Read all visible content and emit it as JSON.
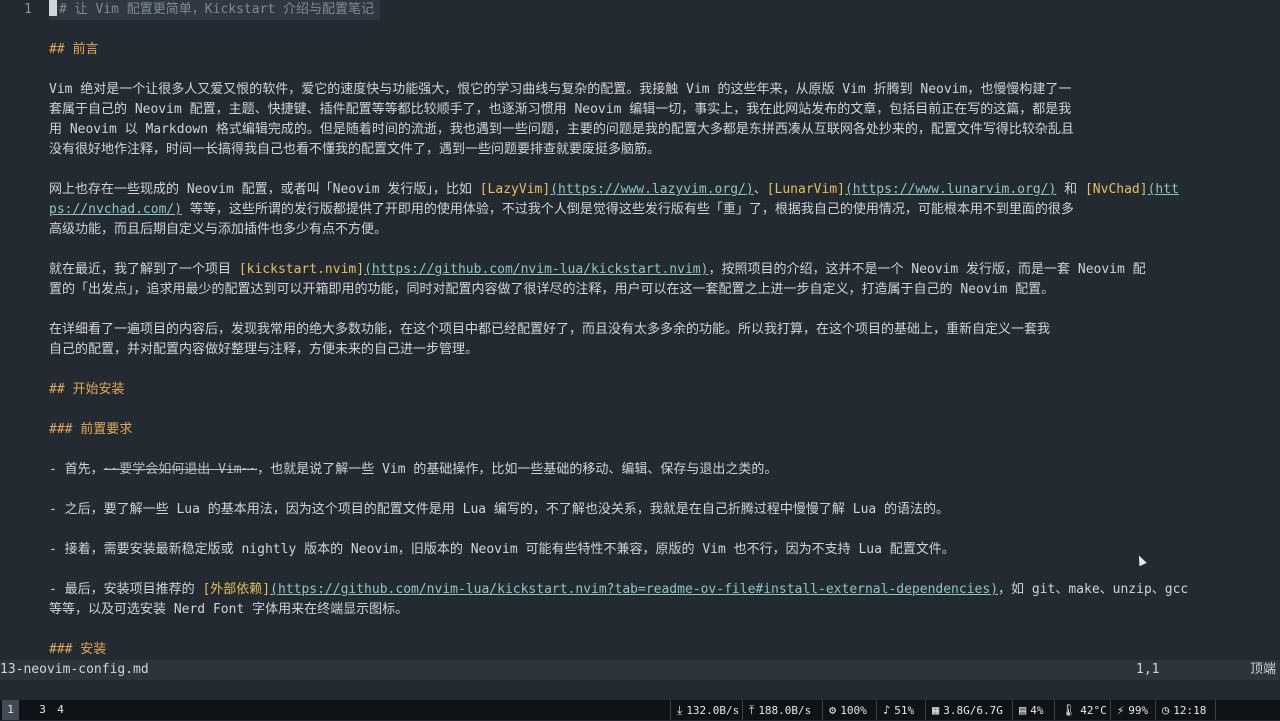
{
  "editor": {
    "line_number": "1",
    "title": "# 让 Vim 配置更简单，Kickstart 介绍与配置笔记",
    "h_preface": "## 前言",
    "p1": [
      "Vim 绝对是一个让很多人又爱又恨的软件，爱它的速度快与功能强大，恨它的学习曲线与复杂的配置。我接触 Vim 的这些年来，从原版 Vim 折腾到 Neovim，也慢慢构建了一",
      "套属于自己的 Neovim 配置，主题、快捷键、插件配置等等都比较顺手了，也逐渐习惯用 Neovim 编辑一切，事实上，我在此网站发布的文章，包括目前正在写的这篇，都是我",
      "用 Neovim 以 Markdown 格式编辑完成的。但是随着时间的流逝，我也遇到一些问题，主要的问题是我的配置大多都是东拼西凑从互联网各处抄来的，配置文件写得比较杂乱且",
      "没有很好地作注释，时间一长搞得我自己也看不懂我的配置文件了，遇到一些问题要排查就要废挺多脑筋。"
    ],
    "p2": {
      "l1_pre": "网上也存在一些现成的 Neovim 配置，或者叫「Neovim 发行版」，比如 ",
      "l1_link1": "[LazyVim]",
      "l1_url1": "(https://www.lazyvim.org/)",
      "l1_sep1": "、",
      "l1_link2": "[LunarVim]",
      "l1_url2": "(https://www.lunarvim.org/)",
      "l1_sep2": " 和 ",
      "l1_link3": "[NvChad]",
      "l1_url3a": "(htt",
      "l2_url3b": "ps://nvchad.com/)",
      "l2_rest": " 等等，这些所谓的发行版都提供了开即用的使用体验，不过我个人倒是觉得这些发行版有些「重」了，根据我自己的使用情况，可能根本用不到里面的很多",
      "l3": "高级功能，而且后期自定义与添加插件也多少有点不方便。"
    },
    "p3": {
      "l1_pre": "就在最近，我了解到了一个项目 ",
      "l1_link": "[kickstart.nvim]",
      "l1_url": "(https://github.com/nvim-lua/kickstart.nvim)",
      "l1_rest": "，按照项目的介绍，这并不是一个 Neovim 发行版，而是一套 Neovim 配",
      "l2": "置的「出发点」，追求用最少的配置达到可以开箱即用的功能，同时对配置内容做了很详尽的注释，用户可以在这一套配置之上进一步自定义，打造属于自己的 Neovim 配置。"
    },
    "p4": [
      "在详细看了一遍项目的内容后，发现我常用的绝大多数功能，在这个项目中都已经配置好了，而且没有太多多余的功能。所以我打算，在这个项目的基础上，重新自定义一套我",
      "自己的配置，并对配置内容做好整理与注释，方便未来的自己进一步管理。"
    ],
    "h_install": "## 开始安装",
    "h_prereq": "### 前置要求",
    "b1": {
      "pre": "- 首先，",
      "strike": "~~要学会如何退出 Vim~~",
      "rest": "，也就是说了解一些 Vim 的基础操作，比如一些基础的移动、编辑、保存与退出之类的。"
    },
    "b2": "- 之后，要了解一些 Lua 的基本用法，因为这个项目的配置文件是用 Lua 编写的，不了解也没关系，我就是在自己折腾过程中慢慢了解 Lua 的语法的。",
    "b3": "- 接着，需要安装最新稳定版或 nightly 版本的 Neovim，旧版本的 Neovim 可能有些特性不兼容，原版的 Vim 也不行，因为不支持 Lua 配置文件。",
    "b4": {
      "pre": "- 最后，安装项目推荐的 ",
      "link": "[外部依赖]",
      "url": "(https://github.com/nvim-lua/kickstart.nvim?tab=readme-ov-file#install-external-dependencies)",
      "rest": "，如 git、make、unzip、gcc",
      "l2": "等等，以及可选安装 Nerd Font 字体用来在终端显示图标。"
    },
    "h_setup": "### 安装"
  },
  "statusline": {
    "filename": "13-neovim-config.md",
    "position": "1,1",
    "percent": "顶端"
  },
  "bar": {
    "workspaces": [
      "1",
      "3",
      "4"
    ],
    "active_workspace": "1",
    "net_down": "132.0B/s",
    "net_up": "188.0B/s",
    "cpu_freq": "100%",
    "volume": "51%",
    "memory": "3.8G/6.7G",
    "disk": "4%",
    "temperature": "42°C",
    "battery": "99%",
    "clock": "12:18"
  },
  "icons": {
    "download": "download-icon",
    "upload": "upload-icon",
    "cpu": "cpu-icon",
    "volume": "volume-icon",
    "memory": "memory-icon",
    "disk": "disk-icon",
    "temperature": "thermometer-icon",
    "battery": "battery-icon",
    "clock": "clock-icon"
  }
}
